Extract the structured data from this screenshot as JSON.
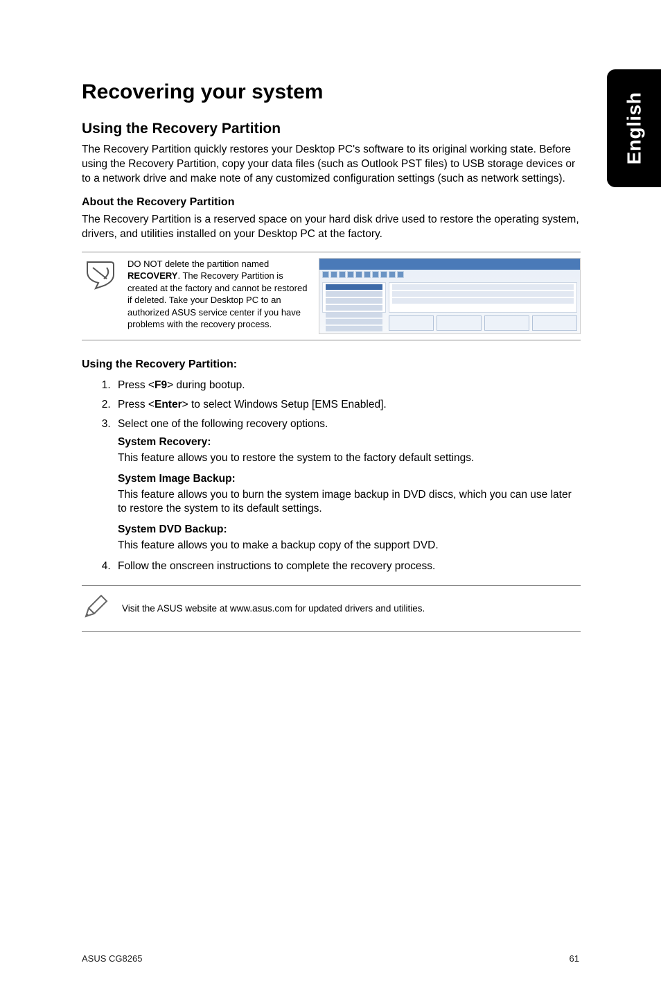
{
  "sidetab": {
    "label": "English"
  },
  "title": "Recovering your system",
  "section1": {
    "heading": "Using the Recovery Partition",
    "para": "The Recovery Partition quickly restores your Desktop PC's software to its original working state. Before using the Recovery Partition, copy your data files (such as Outlook PST files) to USB storage devices or to a network drive and make note of any customized configuration settings (such as network settings)."
  },
  "section2": {
    "heading": "About the Recovery Partition",
    "para": "The Recovery Partition is a reserved space on your hard disk drive used to restore the operating system, drivers, and utilities installed on your Desktop PC at the factory."
  },
  "callout": {
    "text_prefix": "DO NOT delete the partition named ",
    "text_strong": "RECOVERY",
    "text_suffix": ". The Recovery Partition is created at the factory and cannot be restored if deleted. Take your Desktop PC to an authorized ASUS service center if you have problems with the recovery process."
  },
  "section3": {
    "heading": "Using the Recovery Partition:",
    "steps": [
      {
        "pre": "Press <",
        "key": "F9",
        "post": "> during bootup."
      },
      {
        "pre": "Press <",
        "key": "Enter",
        "post": "> to select Windows Setup [EMS Enabled]."
      },
      {
        "plain": "Select one of the following recovery options."
      },
      {
        "plain": "Follow the onscreen instructions to complete the recovery process."
      }
    ],
    "options": [
      {
        "heading": "System Recovery:",
        "body": "This feature allows you to restore the system to the factory default settings."
      },
      {
        "heading": "System Image Backup:",
        "body": "This feature allows you to burn the system image backup in DVD discs, which you can use later to restore the system to its default settings."
      },
      {
        "heading": "System DVD Backup:",
        "body": "This feature allows you to make a backup copy of the support DVD."
      }
    ]
  },
  "note": {
    "text": "Visit the ASUS website at www.asus.com for updated drivers and utilities."
  },
  "footer": {
    "left": "ASUS CG8265",
    "right": "61"
  }
}
